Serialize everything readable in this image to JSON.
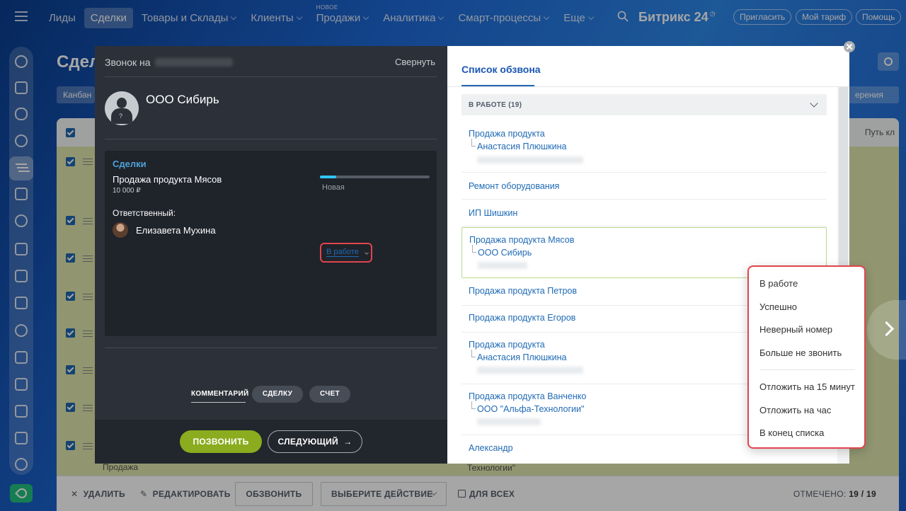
{
  "topnav": {
    "items": [
      {
        "label": "Лиды",
        "chevron": false,
        "active": false
      },
      {
        "label": "Сделки",
        "chevron": false,
        "active": true
      },
      {
        "label": "Товары и Склады",
        "chevron": true,
        "active": false
      },
      {
        "label": "Клиенты",
        "chevron": true,
        "active": false
      },
      {
        "label": "Продажи",
        "chevron": true,
        "active": false,
        "badge": "НОВОЕ"
      },
      {
        "label": "Аналитика",
        "chevron": true,
        "active": false
      },
      {
        "label": "Смарт-процессы",
        "chevron": true,
        "active": false
      },
      {
        "label": "Еще",
        "chevron": true,
        "active": false
      }
    ],
    "brand": "Битрикс 24",
    "invite": "Пригласить",
    "tariff": "Мой тариф",
    "help": "Помощь"
  },
  "page": {
    "title": "Сдел",
    "kanban": "Канбан",
    "right_filter": "ерения"
  },
  "grid": {
    "path_col": "Путь кл",
    "under_modal_1": "Продажа",
    "under_modal_2": "Технологии\""
  },
  "bottombar": {
    "delete": "УДАЛИТЬ",
    "edit": "РЕДАКТИРОВАТЬ",
    "call_btn": "ОБЗВОНИТЬ",
    "choose_action": "ВЫБЕРИТЕ ДЕЙСТВИЕ",
    "for_all": "ДЛЯ ВСЕХ",
    "checked_label": "ОТМЕЧЕНО:",
    "checked_value": "19 / 19"
  },
  "call": {
    "header": "Звонок на",
    "minimize": "Свернуть",
    "contact": "ООО Сибирь",
    "deals_title": "Сделки",
    "deal_name": "Продажа продукта Мясов",
    "deal_sum": "10 000 ₽",
    "deal_progress": 0.15,
    "deal_stage": "Новая",
    "responsible_label": "Ответственный:",
    "responsible_name": "Елизавета Мухина",
    "tabs": [
      "КОММЕНТАРИЙ",
      "СДЕЛКУ",
      "СЧЕТ"
    ],
    "btn_call": "ПОЗВОНИТЬ",
    "btn_next": "СЛЕДУЮЩИЙ"
  },
  "calllist": {
    "title": "Список обзвона",
    "group": "В РАБОТЕ (19)",
    "items": [
      {
        "title": "Продажа продукта",
        "sub": "Анастасия Плюшкина"
      },
      {
        "title": "Ремонт оборудования"
      },
      {
        "title": "ИП Шишкин"
      },
      {
        "title": "Продажа продукта Мясов",
        "sub": "ООО Сибирь"
      },
      {
        "title": "Продажа продукта Петров"
      },
      {
        "title": "Продажа продукта Егоров"
      },
      {
        "title": "Продажа продукта",
        "sub": "Анастасия Плюшкина"
      },
      {
        "title": "Продажа продукта Ванченко",
        "sub": "ООО \"Альфа-Технологии\""
      },
      {
        "title": "Александр"
      }
    ],
    "status": "В работе"
  },
  "status_menu": {
    "items": [
      "В работе",
      "Успешно",
      "Неверный номер",
      "Больше не звонить",
      "Отложить на 15 минут",
      "Отложить на час",
      "В конец списка"
    ]
  }
}
